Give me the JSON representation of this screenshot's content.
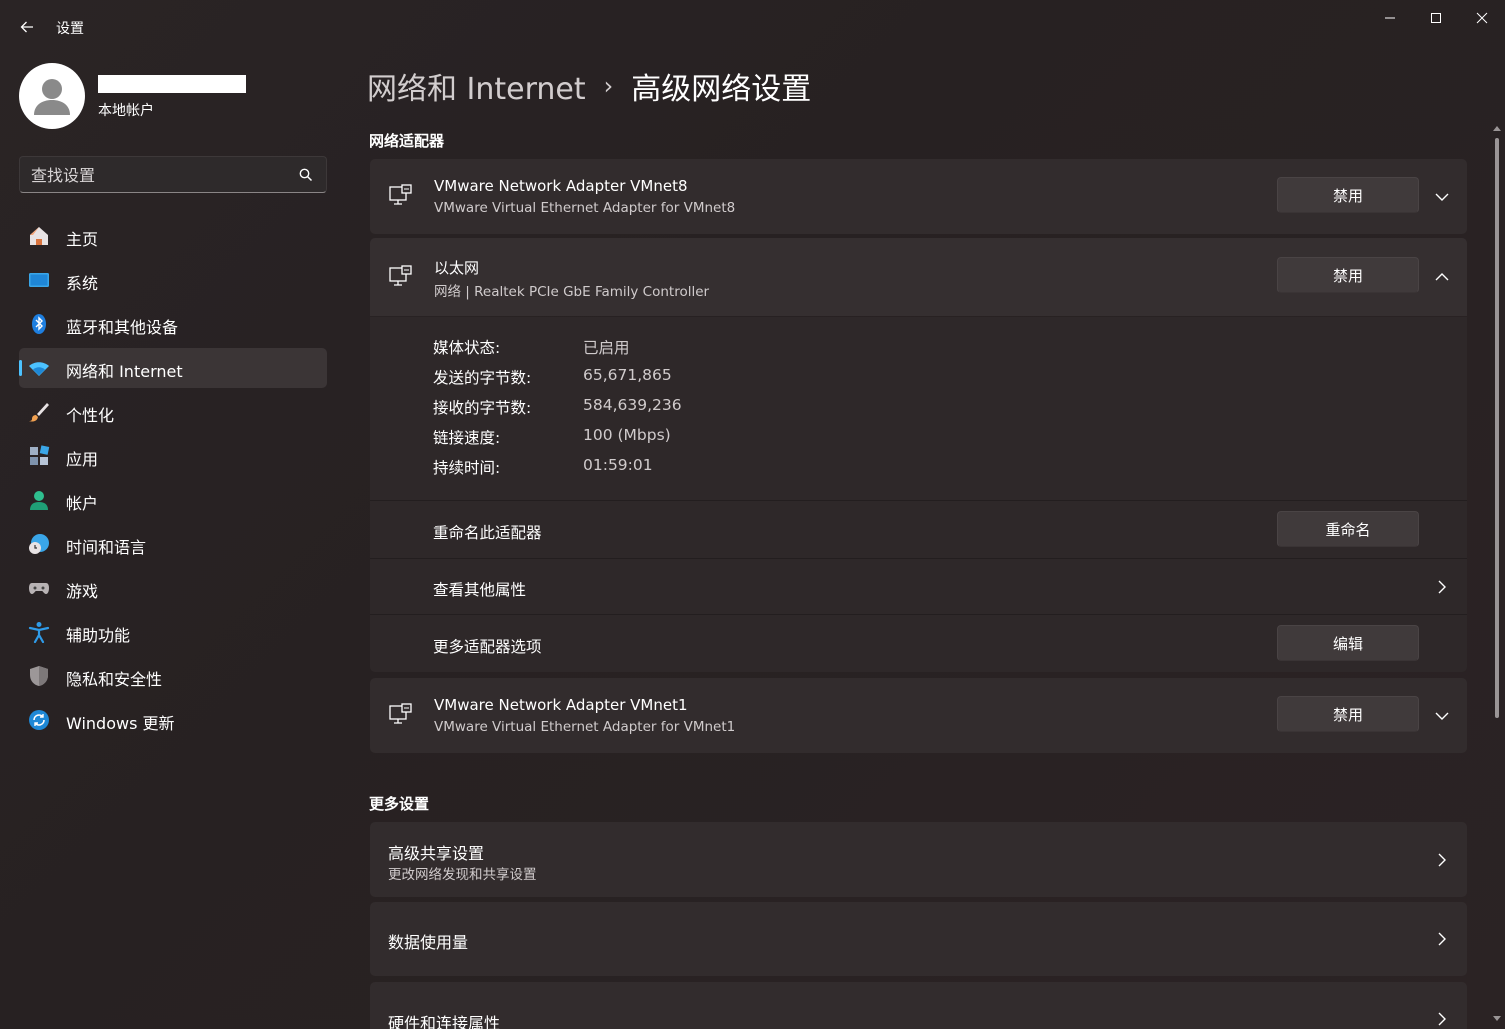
{
  "app": {
    "title": "设置"
  },
  "profile": {
    "account_type": "本地帐户"
  },
  "search": {
    "placeholder": "查找设置"
  },
  "sidebar": {
    "items": [
      {
        "label": "主页",
        "icon": "home-icon"
      },
      {
        "label": "系统",
        "icon": "system-icon"
      },
      {
        "label": "蓝牙和其他设备",
        "icon": "bluetooth-icon"
      },
      {
        "label": "网络和 Internet",
        "icon": "wifi-icon",
        "active": true
      },
      {
        "label": "个性化",
        "icon": "brush-icon"
      },
      {
        "label": "应用",
        "icon": "apps-icon"
      },
      {
        "label": "帐户",
        "icon": "account-icon"
      },
      {
        "label": "时间和语言",
        "icon": "time-language-icon"
      },
      {
        "label": "游戏",
        "icon": "gamepad-icon"
      },
      {
        "label": "辅助功能",
        "icon": "accessibility-icon"
      },
      {
        "label": "隐私和安全性",
        "icon": "shield-icon"
      },
      {
        "label": "Windows 更新",
        "icon": "update-icon"
      }
    ]
  },
  "breadcrumb": {
    "parent": "网络和 Internet",
    "separator": "›",
    "current": "高级网络设置"
  },
  "adapters_section": {
    "title": "网络适配器"
  },
  "adapters": [
    {
      "name": "VMware Network Adapter VMnet8",
      "desc": "VMware Virtual Ethernet Adapter for VMnet8",
      "button": "禁用"
    },
    {
      "name": "以太网",
      "desc": "网络 | Realtek PCIe GbE Family Controller",
      "button": "禁用"
    },
    {
      "name": "VMware Network Adapter VMnet1",
      "desc": "VMware Virtual Ethernet Adapter for VMnet1",
      "button": "禁用"
    }
  ],
  "ethernet_details": {
    "props": [
      {
        "label": "媒体状态:",
        "value": "已启用"
      },
      {
        "label": "发送的字节数:",
        "value": "65,671,865"
      },
      {
        "label": "接收的字节数:",
        "value": "584,639,236"
      },
      {
        "label": "链接速度:",
        "value": "100 (Mbps)"
      },
      {
        "label": "持续时间:",
        "value": "01:59:01"
      }
    ],
    "rename": {
      "label": "重命名此适配器",
      "button": "重命名"
    },
    "view_props": {
      "label": "查看其他属性"
    },
    "more_options": {
      "label": "更多适配器选项",
      "button": "编辑"
    }
  },
  "more_section": {
    "title": "更多设置"
  },
  "more_settings": [
    {
      "title": "高级共享设置",
      "desc": "更改网络发现和共享设置"
    },
    {
      "title": "数据使用量",
      "desc": ""
    },
    {
      "title": "硬件和连接属性",
      "desc": ""
    }
  ],
  "colors": {
    "accent": "#4cc2ff",
    "background": "#272122",
    "card": "#322c2d"
  }
}
